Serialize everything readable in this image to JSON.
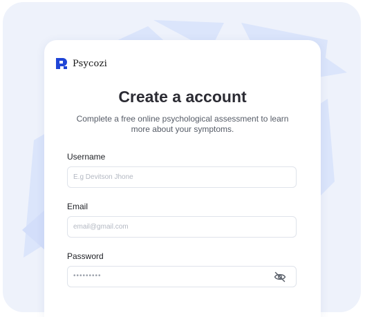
{
  "brand": {
    "name": "Psycozi",
    "logo_icon": "psycozi-logo-icon",
    "color": "#1f45d6"
  },
  "header": {
    "title": "Create a account",
    "subtitle": "Complete a free online psychological assessment to learn more about your symptoms."
  },
  "form": {
    "username": {
      "label": "Username",
      "placeholder": "E.g Devitson Jhone",
      "value": ""
    },
    "email": {
      "label": "Email",
      "placeholder": "email@gmail.com",
      "value": ""
    },
    "password": {
      "label": "Password",
      "masked_value": "•••••••••",
      "toggle_icon": "eye-off-icon"
    }
  },
  "colors": {
    "background_panel": "#eef2fb",
    "background_shapes": "#dbe5fb",
    "text_primary": "#2b2b33"
  }
}
